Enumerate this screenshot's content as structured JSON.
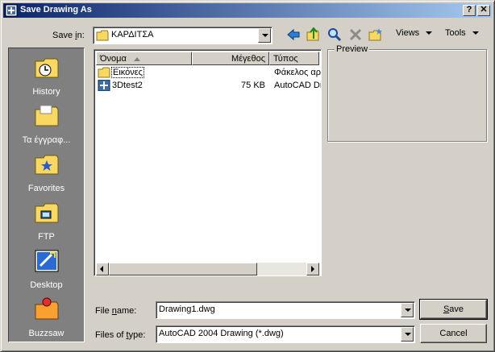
{
  "window": {
    "title": "Save Drawing As",
    "help_glyph": "?",
    "close_glyph": "✕"
  },
  "save_in": {
    "label_pre": "Save ",
    "label_accel": "i",
    "label_post": "n:",
    "value": "ΚΑΡΔΙΤΣΑ",
    "icon": "folder-icon"
  },
  "toolbar": {
    "buttons": [
      "back-icon",
      "up-folder-icon",
      "search-web-icon",
      "delete-icon",
      "create-folder-icon"
    ],
    "views_label": "Views",
    "tools_label": "Tools"
  },
  "places": [
    {
      "label": "History",
      "icon": "history-icon"
    },
    {
      "label": "Τα έγγραφ...",
      "icon": "documents-icon"
    },
    {
      "label": "Favorites",
      "icon": "favorites-icon"
    },
    {
      "label": "FTP",
      "icon": "ftp-icon"
    },
    {
      "label": "Desktop",
      "icon": "desktop-icon"
    },
    {
      "label": "Buzzsaw",
      "icon": "buzzsaw-icon"
    }
  ],
  "filelist": {
    "columns": [
      "Όνομα",
      "Μέγεθος",
      "Τύπος"
    ],
    "rows": [
      {
        "name": "Εικόνες",
        "size": "",
        "type": "Φάκελος αρ",
        "icon": "folder-icon"
      },
      {
        "name": "3Dtest2",
        "size": "75 KB",
        "type": "AutoCAD Dr",
        "icon": "dwg-file-icon"
      }
    ]
  },
  "preview": {
    "label": "Preview"
  },
  "file_name": {
    "label_pre": "File ",
    "label_accel": "n",
    "label_post": "ame:",
    "value": "Drawing1.dwg"
  },
  "file_type": {
    "label_pre": "Files of ",
    "label_accel": "t",
    "label_post": "ype:",
    "value": "AutoCAD 2004 Drawing (*.dwg)"
  },
  "buttons": {
    "save_label": "Save",
    "save_accel": "S",
    "save_rest": "ave",
    "cancel_label": "Cancel"
  },
  "colors": {
    "title_start": "#0a246a",
    "title_end": "#a6caf0",
    "face": "#d4d0c8",
    "places_bg": "#808080",
    "folder": "#f8d860"
  }
}
